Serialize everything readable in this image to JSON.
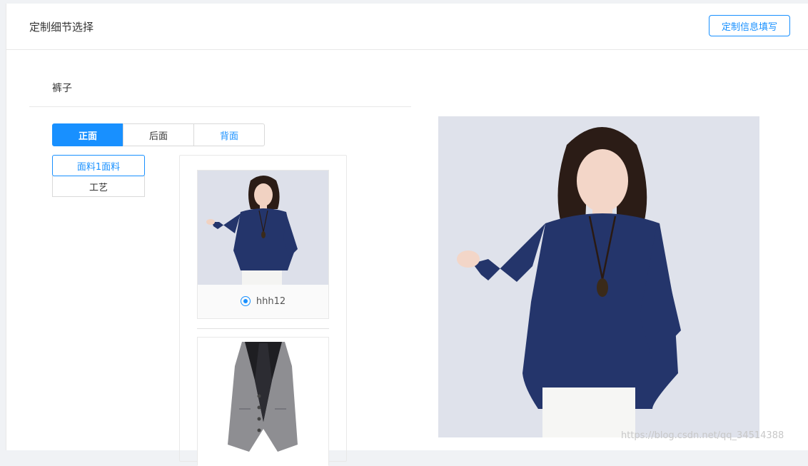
{
  "header": {
    "title": "定制细节选择",
    "fill_button": "定制信息填写"
  },
  "section": {
    "title": "裤子"
  },
  "tabs": [
    {
      "label": "正面"
    },
    {
      "label": "后面"
    },
    {
      "label": "背面"
    }
  ],
  "subtabs": [
    {
      "label": "面料1面料"
    },
    {
      "label": "工艺"
    }
  ],
  "options": [
    {
      "label": "hhh12",
      "selected": true
    }
  ],
  "watermark": "https://blog.csdn.net/qq_34514388",
  "colors": {
    "accent": "#1890ff",
    "garment": "#24356b"
  }
}
